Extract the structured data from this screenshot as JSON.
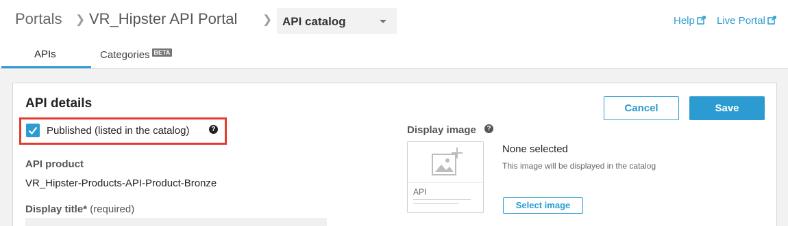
{
  "header": {
    "breadcrumb": [
      "Portals",
      "VR_Hipster API Portal"
    ],
    "dropdown_value": "API catalog",
    "links": {
      "help": "Help",
      "live_portal": "Live Portal"
    }
  },
  "tabs": [
    {
      "label": "APIs",
      "active": true
    },
    {
      "label": "Categories",
      "badge": "BETA"
    }
  ],
  "details": {
    "title": "API details",
    "cancel_label": "Cancel",
    "save_label": "Save",
    "published_label": "Published (listed in the catalog)",
    "published_checked": true,
    "help_glyph": "?",
    "api_product_label": "API product",
    "api_product_value": "VR_Hipster-Products-API-Product-Bronze",
    "display_title_label": "Display title*",
    "display_title_required": "(required)",
    "display_title_value": "",
    "display_image_label": "Display image",
    "thumbnail_text": "API",
    "none_selected": "None selected",
    "image_hint": "This image will be displayed in the catalog",
    "select_image_label": "Select image"
  },
  "colors": {
    "accent": "#2b9bd1",
    "highlight": "#e43b2c"
  }
}
